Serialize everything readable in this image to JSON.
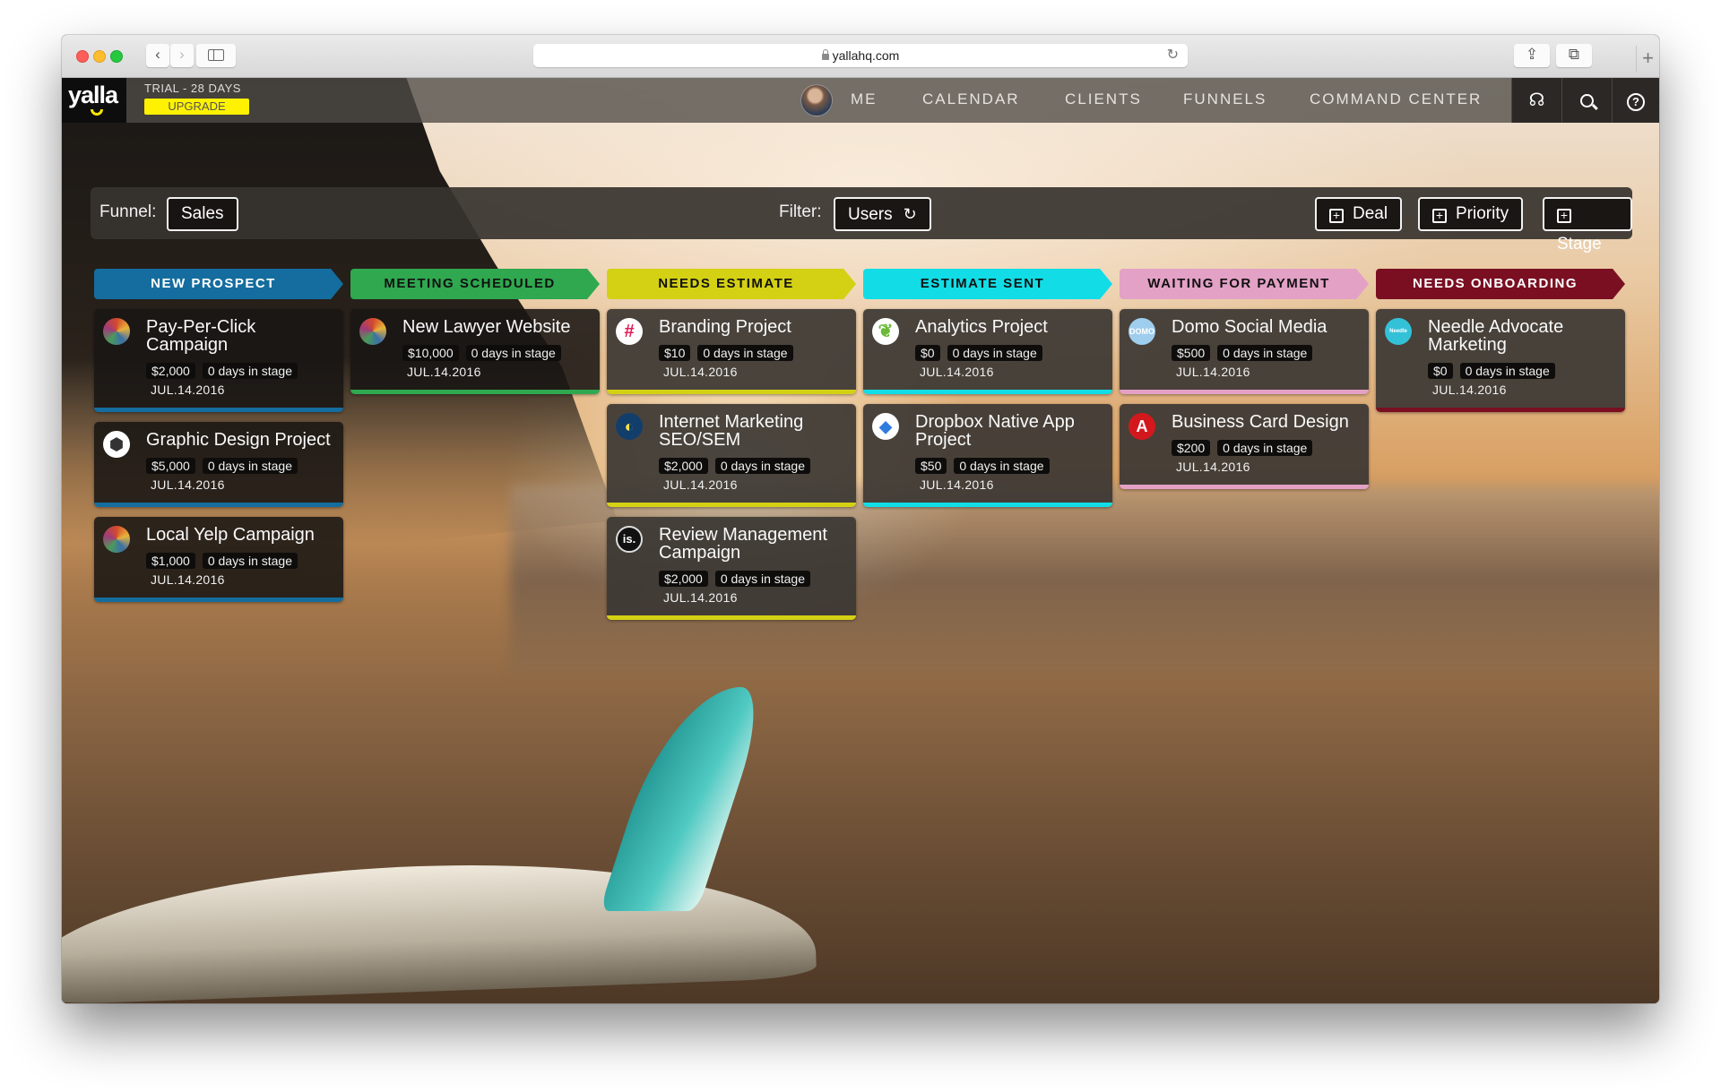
{
  "browser": {
    "url": "yallahq.com",
    "back_glyph": "‹",
    "forward_glyph": "›",
    "reload_glyph": "↻",
    "share_glyph": "⇪",
    "tabs_glyph": "⧉",
    "newtab_glyph": "+"
  },
  "app": {
    "logo": "yalla",
    "trial_text": "TRIAL - 28 DAYS",
    "upgrade_label": "UPGRADE",
    "nav": [
      "ME",
      "CALENDAR",
      "CLIENTS",
      "FUNNELS",
      "COMMAND CENTER"
    ],
    "icons": {
      "broadcast": "☊",
      "help": "?"
    }
  },
  "toolbar": {
    "funnel_label": "Funnel:",
    "funnel_value": "Sales",
    "filter_label": "Filter:",
    "filter_value": "Users",
    "refresh_glyph": "↻",
    "add_deal": "Deal",
    "add_priority": "Priority",
    "add_stage": "Stage",
    "plus_glyph": "+"
  },
  "stages": [
    {
      "name": "NEW PROSPECT",
      "color": "#146d9e",
      "text_color": "#ffffff",
      "cards": [
        {
          "title": "Pay-Per-Click Campaign",
          "value": "$2,000",
          "days": "0 days in stage",
          "date": "JUL.14.2016",
          "icon": "art-avatar-icon",
          "icon_glyph": ""
        },
        {
          "title": "Graphic Design Project",
          "value": "$5,000",
          "days": "0 days in stage",
          "date": "JUL.14.2016",
          "icon": "hexagon-logo-icon",
          "icon_glyph": ""
        },
        {
          "title": "Local Yelp Campaign",
          "value": "$1,000",
          "days": "0 days in stage",
          "date": "JUL.14.2016",
          "icon": "art-avatar-icon",
          "icon_glyph": ""
        }
      ]
    },
    {
      "name": "MEETING SCHEDULED",
      "color": "#2fa84f",
      "text_color": "#111111",
      "cards": [
        {
          "title": "New Lawyer Website",
          "value": "$10,000",
          "days": "0 days in stage",
          "date": "JUL.14.2016",
          "icon": "art-avatar-icon",
          "icon_glyph": ""
        }
      ]
    },
    {
      "name": "NEEDS ESTIMATE",
      "color": "#d4d114",
      "text_color": "#111111",
      "cards": [
        {
          "title": "Branding Project",
          "value": "$10",
          "days": "0 days in stage",
          "date": "JUL.14.2016",
          "icon": "slack-logo-icon",
          "icon_glyph": "#"
        },
        {
          "title": "Internet Marketing SEO/SEM",
          "value": "$2,000",
          "days": "0 days in stage",
          "date": "JUL.14.2016",
          "icon": "lemon-logo-icon",
          "icon_glyph": "◐"
        },
        {
          "title": "Review Management Campaign",
          "value": "$2,000",
          "days": "0 days in stage",
          "date": "JUL.14.2016",
          "icon": "is-logo-icon",
          "icon_glyph": "is."
        }
      ]
    },
    {
      "name": "ESTIMATE SENT",
      "color": "#12dde6",
      "text_color": "#111111",
      "cards": [
        {
          "title": "Analytics Project",
          "value": "$0",
          "days": "0 days in stage",
          "date": "JUL.14.2016",
          "icon": "leaf-logo-icon",
          "icon_glyph": "❦"
        },
        {
          "title": "Dropbox Native App Project",
          "value": "$50",
          "days": "0 days in stage",
          "date": "JUL.14.2016",
          "icon": "dropbox-logo-icon",
          "icon_glyph": "◆"
        }
      ]
    },
    {
      "name": "WAITING FOR PAYMENT",
      "color": "#e3a1c6",
      "text_color": "#111111",
      "cards": [
        {
          "title": "Domo Social Media",
          "value": "$500",
          "days": "0 days in stage",
          "date": "JUL.14.2016",
          "icon": "domo-logo-icon",
          "icon_glyph": "DOMO"
        },
        {
          "title": "Business Card Design",
          "value": "$200",
          "days": "0 days in stage",
          "date": "JUL.14.2016",
          "icon": "adobe-logo-icon",
          "icon_glyph": "A"
        }
      ]
    },
    {
      "name": "NEEDS ONBOARDING",
      "color": "#7a0f22",
      "text_color": "#ffffff",
      "cards": [
        {
          "title": "Needle Advocate Marketing",
          "value": "$0",
          "days": "0 days in stage",
          "date": "JUL.14.2016",
          "icon": "needle-logo-icon",
          "icon_glyph": "Needle"
        }
      ]
    }
  ]
}
